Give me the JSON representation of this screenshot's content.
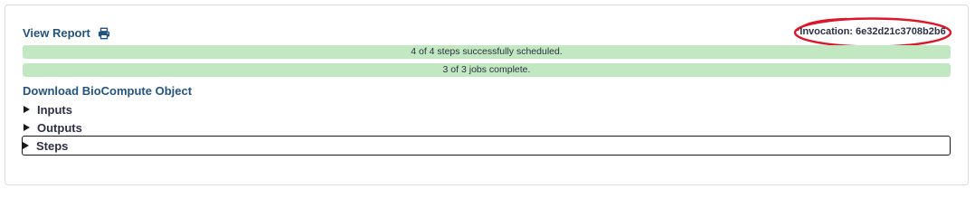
{
  "header": {
    "view_report_label": "View Report",
    "invocation_label": "Invocation: 6e32d21c3708b2b6"
  },
  "progress": {
    "steps_text": "4 of 4 steps successfully scheduled.",
    "steps_fraction": 1.0,
    "jobs_text": "3 of 3 jobs complete.",
    "jobs_fraction": 1.0
  },
  "links": {
    "download_biocompute": "Download BioCompute Object"
  },
  "sections": {
    "inputs": "Inputs",
    "outputs": "Outputs",
    "steps": "Steps"
  },
  "icons": {
    "print": "print-icon",
    "caret": "caret-right-icon"
  },
  "colors": {
    "link": "#25537b",
    "progress_fill": "#c1e8c1",
    "annotation_oval": "#d9182a"
  }
}
